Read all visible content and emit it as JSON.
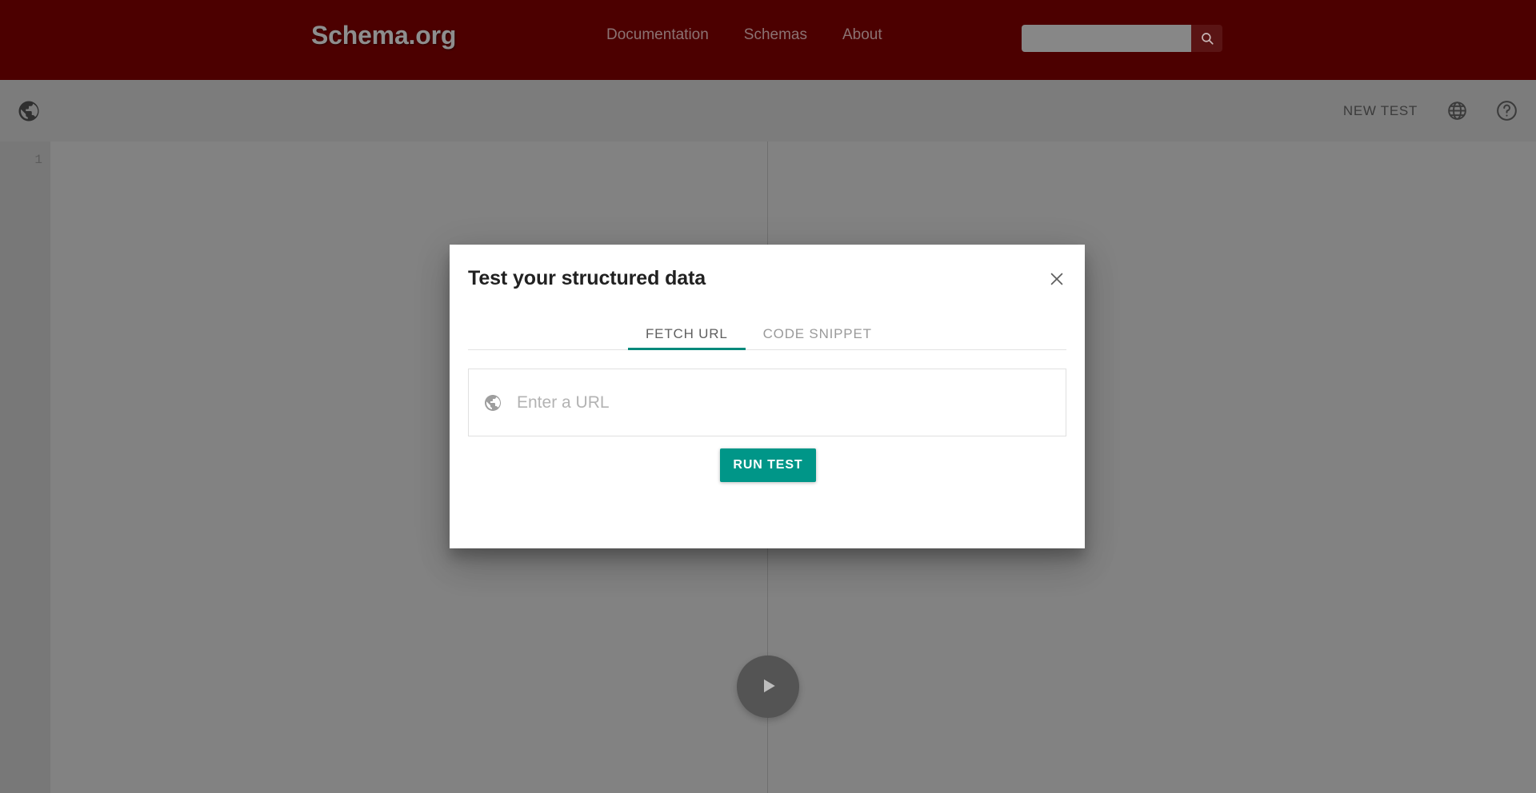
{
  "site_header": {
    "logo": "Schema.org",
    "nav": [
      {
        "label": "Documentation"
      },
      {
        "label": "Schemas"
      },
      {
        "label": "About"
      }
    ],
    "search": {
      "value": "",
      "placeholder": "",
      "icon": "search-icon"
    },
    "colors": {
      "background": "#4c0000",
      "search_button": "#5a1414"
    }
  },
  "app_toolbar": {
    "brand_icon": "globe-icon",
    "new_test_label": "NEW TEST",
    "language_icon": "language-globe-icon",
    "help_icon": "help-circle-icon",
    "background": "#7c7c7c"
  },
  "workspace": {
    "gutter": {
      "line_numbers": [
        "1"
      ]
    },
    "run_fab": {
      "icon": "play-icon"
    }
  },
  "dialog": {
    "title": "Test your structured data",
    "close_icon": "close-icon",
    "tabs": [
      {
        "label": "FETCH URL",
        "active": true
      },
      {
        "label": "CODE SNIPPET",
        "active": false
      }
    ],
    "url_input": {
      "icon": "globe-icon",
      "value": "",
      "placeholder": "Enter a URL"
    },
    "run_button_label": "RUN TEST",
    "colors": {
      "accent": "#009688",
      "tab_underline": "#00897b",
      "title_text": "#212121"
    }
  }
}
